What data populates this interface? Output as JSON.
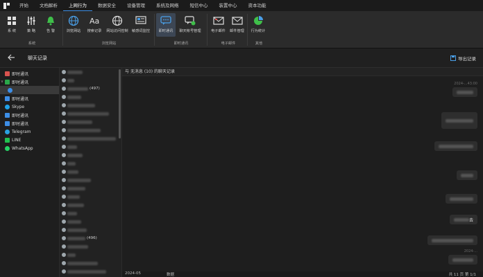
{
  "menubar": {
    "items": [
      "开始",
      "文档解析",
      "上网行为",
      "数据安全",
      "设备管理",
      "系统及网络",
      "短信中心",
      "装置中心",
      "资本功能"
    ],
    "active_index": 2
  },
  "ribbon": {
    "groups": [
      {
        "title": "系统",
        "buttons": [
          {
            "label": "系 统",
            "icon": "grid-icon"
          },
          {
            "label": "策 略",
            "icon": "sliders-icon"
          },
          {
            "label": "告 警",
            "icon": "bell-icon"
          }
        ]
      },
      {
        "title": "浏览网站",
        "buttons": [
          {
            "label": "浏览网站",
            "icon": "globe-icon"
          },
          {
            "label": "搜索记录",
            "icon": "text-icon"
          },
          {
            "label": "网站访问控制",
            "icon": "globe-shield-icon"
          },
          {
            "label": "敏感词监控",
            "icon": "monitor-icon"
          }
        ]
      },
      {
        "title": "即时通讯",
        "buttons": [
          {
            "label": "即时通讯",
            "icon": "chat-icon",
            "active": true
          },
          {
            "label": "聊天帐号管理",
            "icon": "chat-manage-icon"
          }
        ]
      },
      {
        "title": "电子邮件",
        "buttons": [
          {
            "label": "电子邮件",
            "icon": "mail-icon"
          },
          {
            "label": "邮件管理",
            "icon": "mail-manage-icon"
          }
        ]
      },
      {
        "title": "其他",
        "buttons": [
          {
            "label": "行为统计",
            "icon": "stats-icon"
          }
        ]
      }
    ]
  },
  "nav": {
    "title": "聊天记录",
    "export_label": "导出记录"
  },
  "tree": {
    "items": [
      {
        "label": "即时通讯",
        "color": "#d9534f",
        "caret": "",
        "indent": 0
      },
      {
        "label": "即时通讯",
        "color": "#2aa84a",
        "caret": "v",
        "indent": 0
      },
      {
        "label": "",
        "color": "#3d8ee6",
        "caret": "",
        "indent": 1,
        "selected": true
      },
      {
        "label": "即时通讯",
        "color": "#3d8ee6",
        "caret": "",
        "indent": 0
      },
      {
        "label": "Skype",
        "color": "#1fa2e8",
        "caret": "",
        "indent": 0
      },
      {
        "label": "即时通讯",
        "color": "#3d8ee6",
        "caret": "",
        "indent": 0
      },
      {
        "label": "即时通讯",
        "color": "#3d8ee6",
        "caret": "",
        "indent": 0
      },
      {
        "label": "Telegram",
        "color": "#2aa1e0",
        "caret": "",
        "indent": 0
      },
      {
        "label": "LINE",
        "color": "#21c150",
        "caret": "",
        "indent": 0
      },
      {
        "label": "WhatsApp",
        "color": "#25d366",
        "caret": "",
        "indent": 0
      }
    ]
  },
  "contacts": [
    {
      "text": ""
    },
    {
      "text": ""
    },
    {
      "text": "(497)"
    },
    {
      "text": ""
    },
    {
      "text": ""
    },
    {
      "text": ""
    },
    {
      "text": ""
    },
    {
      "text": ""
    },
    {
      "text": ""
    },
    {
      "text": ""
    },
    {
      "text": ""
    },
    {
      "text": ""
    },
    {
      "text": ""
    },
    {
      "text": ""
    },
    {
      "text": ""
    },
    {
      "text": ""
    },
    {
      "text": ""
    },
    {
      "text": ""
    },
    {
      "text": ""
    },
    {
      "text": ""
    },
    {
      "text": "(496)"
    },
    {
      "text": ""
    },
    {
      "text": ""
    },
    {
      "text": ""
    },
    {
      "text": ""
    }
  ],
  "chat": {
    "header": "与 无消息 (10) 的聊天记录"
  },
  "messages": [
    {
      "time": "2024-...43:00",
      "tail": ""
    },
    {
      "time": "",
      "tail": ""
    },
    {
      "time": "",
      "tail": ""
    },
    {
      "time": "",
      "tail": ""
    },
    {
      "time": "",
      "tail": ""
    },
    {
      "time": "",
      "tail": "去"
    },
    {
      "time": "",
      "tail": ""
    },
    {
      "time": "2024-...",
      "tail": ""
    }
  ],
  "status": {
    "date": "2024-05",
    "count": "数据",
    "pages": "共 11 页 第 1/1"
  }
}
